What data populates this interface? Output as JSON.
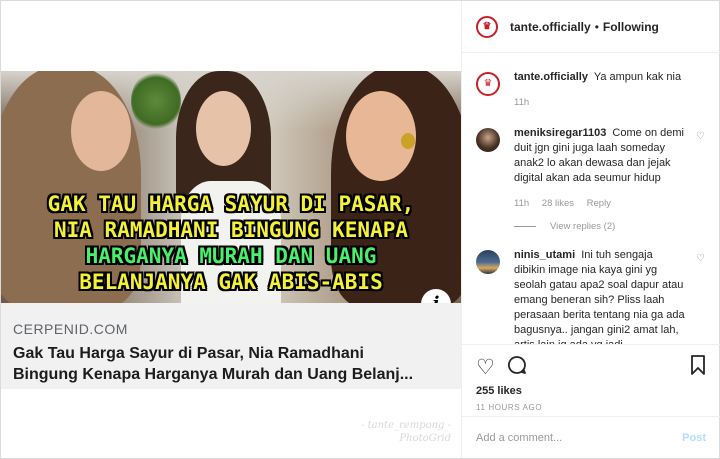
{
  "media": {
    "caption_lines": [
      "GAK TAU HARGA SAYUR DI PASAR,",
      "NIA RAMADHANI BINGUNG KENAPA",
      "HARGANYA MURAH DAN UANG",
      "BELANJANYA GAK ABIS-ABIS"
    ],
    "info_icon_glyph": "i",
    "link_domain": "CERPENID.COM",
    "link_title_line1": "Gak Tau Harga Sayur di Pasar, Nia Ramadhani",
    "link_title_line2": "Bingung Kenapa Harganya Murah dan Uang Belanj...",
    "watermark_line1": "- tante_rempong -",
    "watermark_line2": "PhotoGrid"
  },
  "header": {
    "username": "tante.officially",
    "separator": "•",
    "follow_status": "Following"
  },
  "comments": [
    {
      "username": "tante.officially",
      "text": "Ya ampun kak nia",
      "time": "11h",
      "avatar": "logo"
    },
    {
      "username": "meniksiregar1103",
      "text": "Come on demi duit jgn gini juga laah someday anak2 lo akan dewasa dan jejak digital akan ada seumur hidup",
      "time": "11h",
      "likes": "28 likes",
      "reply": "Reply",
      "view_replies": "View replies (2)",
      "avatar": "photo-dark"
    },
    {
      "username": "ninis_utami",
      "text": "Ini tuh sengaja dibikin image nia kaya gini yg seolah gatau apa2 soal dapur atau emang beneran sih? Pliss laah perasaan berita tentang nia ga ada bagusnya.. jangan gini2 amat lah, artis lain jg ada yg jadi",
      "avatar": "photo-landscape"
    }
  ],
  "actions": {
    "likes": "255 likes",
    "time_ago": "11 HOURS AGO"
  },
  "add_comment": {
    "placeholder": "Add a comment...",
    "post_label": "Post"
  },
  "colors": {
    "caption_yellow": "#f3f13a",
    "caption_green": "#4bf06a",
    "link_bg": "#f1f1f1",
    "post_disabled": "#b2dffc",
    "logo_red": "#c71f2a"
  }
}
